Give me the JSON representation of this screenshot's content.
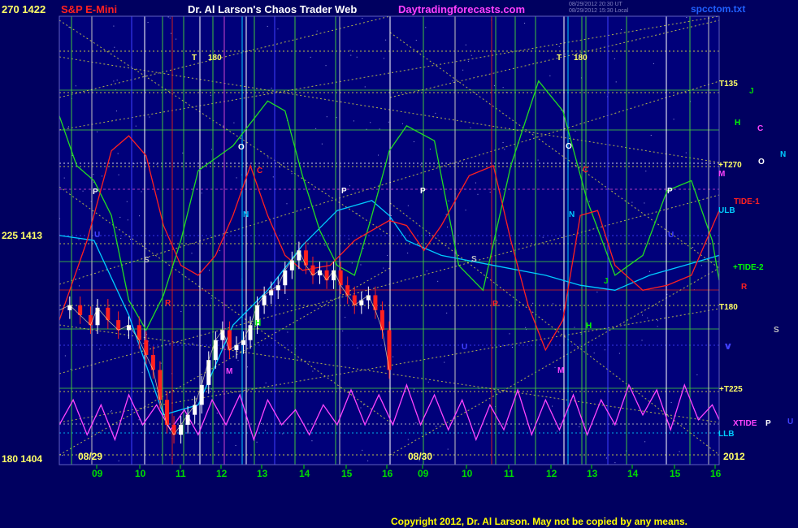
{
  "header": {
    "left_label": "270 1422",
    "instrument": "S&P E-Mini",
    "title": "Dr. Al Larson's Chaos Trader Web",
    "site": "Daytradingforecasts.com",
    "stamp_line1": "08/29/2012 20:30 UT",
    "stamp_line2": "08/29/2012 15:30 Local",
    "file": "spcctom.txt"
  },
  "copyright": "Copyright 2012, Dr. Al Larson. May not be copied by any means.",
  "colors": {
    "background": "#000060",
    "plot_background": "#00007a",
    "title_white": "#ffffff",
    "instrument_red": "#ff2020",
    "site_magenta": "#ff40ff",
    "axis_yellow": "#ffff66",
    "grid_dotted": "#e0e040",
    "price_white": "#ffffff",
    "price_red": "#ff2020"
  },
  "chart_data": {
    "type": "line",
    "title": "S&P E-Mini",
    "xlabel": "",
    "ylabel": "",
    "ylim": [
      1404,
      1422
    ],
    "y_ticks": [
      {
        "label": "270 1422",
        "value": 1422
      },
      {
        "label": "225 1413",
        "value": 1413
      },
      {
        "label": "180 1404",
        "value": 1404
      }
    ],
    "x_tick_labels": [
      "09",
      "10",
      "11",
      "12",
      "13",
      "14",
      "15",
      "16",
      "09",
      "10",
      "11",
      "12",
      "13",
      "14",
      "15",
      "16"
    ],
    "date_labels": [
      "08/29",
      "08/30"
    ],
    "year_label": "2012",
    "grid": true,
    "right_labels": [
      {
        "text": "T135",
        "color": "#ffff66"
      },
      {
        "text": "J",
        "color": "#00dd00"
      },
      {
        "text": "H",
        "color": "#00ff00"
      },
      {
        "text": "C",
        "color": "#ff44ff"
      },
      {
        "text": "N",
        "color": "#00ccff"
      },
      {
        "text": "+T270",
        "color": "#ffff66"
      },
      {
        "text": "O",
        "color": "#ffffff"
      },
      {
        "text": "M",
        "color": "#ff44ff"
      },
      {
        "text": "TIDE-1",
        "color": "#ff2020"
      },
      {
        "text": "ULB",
        "color": "#00ccff"
      },
      {
        "text": "+TIDE-2",
        "color": "#00ff00"
      },
      {
        "text": "R",
        "color": "#ff2020"
      },
      {
        "text": "T180",
        "color": "#ffff66"
      },
      {
        "text": "S",
        "color": "#c0c0c0"
      },
      {
        "text": "V",
        "color": "#4040ff"
      },
      {
        "text": "+T225",
        "color": "#ffff66"
      },
      {
        "text": "XTIDE",
        "color": "#ff44ff"
      },
      {
        "text": "P",
        "color": "#ffffff"
      },
      {
        "text": "U",
        "color": "#4040ff"
      },
      {
        "text": "LLB",
        "color": "#00ccff"
      }
    ],
    "in_plot_labels": [
      {
        "text": "T",
        "color": "#ffff66"
      },
      {
        "text": "180",
        "color": "#ffff66"
      },
      {
        "text": "T",
        "color": "#ffff66"
      },
      {
        "text": "180",
        "color": "#ffff66"
      },
      {
        "text": "P",
        "color": "#ffffff"
      },
      {
        "text": "P",
        "color": "#ffffff"
      },
      {
        "text": "P",
        "color": "#ffffff"
      },
      {
        "text": "P",
        "color": "#ffffff"
      },
      {
        "text": "O",
        "color": "#ffffff"
      },
      {
        "text": "O",
        "color": "#ffffff"
      },
      {
        "text": "C",
        "color": "#ff2020"
      },
      {
        "text": "C",
        "color": "#ff2020"
      },
      {
        "text": "N",
        "color": "#00ccff"
      },
      {
        "text": "N",
        "color": "#00ccff"
      },
      {
        "text": "S",
        "color": "#c0c0c0"
      },
      {
        "text": "S",
        "color": "#c0c0c0"
      },
      {
        "text": "R",
        "color": "#ff2020"
      },
      {
        "text": "R",
        "color": "#ff2020"
      },
      {
        "text": "M",
        "color": "#ff44ff"
      },
      {
        "text": "M",
        "color": "#ff44ff"
      },
      {
        "text": "H",
        "color": "#00ff00"
      },
      {
        "text": "H",
        "color": "#00ff00"
      },
      {
        "text": "J",
        "color": "#00dd00"
      },
      {
        "text": "V",
        "color": "#4040ff"
      },
      {
        "text": "U",
        "color": "#4040ff"
      },
      {
        "text": "U",
        "color": "#4040ff"
      },
      {
        "text": "U",
        "color": "#4040ff"
      }
    ],
    "series": [
      {
        "name": "S&P E-Mini price",
        "color": "#ffffff",
        "points": [
          [
            0,
            1410.2
          ],
          [
            3,
            1410.4
          ],
          [
            6,
            1410.0
          ],
          [
            9,
            1409.6
          ],
          [
            11,
            1410.3
          ],
          [
            14,
            1409.8
          ],
          [
            17,
            1409.4
          ],
          [
            20,
            1409.6
          ],
          [
            23,
            1409.0
          ],
          [
            25,
            1408.4
          ],
          [
            27,
            1407.8
          ],
          [
            29,
            1406.6
          ],
          [
            31,
            1405.6
          ],
          [
            33,
            1405.2
          ],
          [
            35,
            1405.6
          ],
          [
            37,
            1406.0
          ],
          [
            39,
            1406.4
          ],
          [
            41,
            1407.2
          ],
          [
            43,
            1408.2
          ],
          [
            45,
            1409.0
          ],
          [
            47,
            1409.4
          ],
          [
            49,
            1408.6
          ],
          [
            51,
            1408.8
          ],
          [
            53,
            1409.0
          ],
          [
            55,
            1409.6
          ],
          [
            57,
            1410.4
          ],
          [
            59,
            1410.8
          ],
          [
            61,
            1411.0
          ],
          [
            63,
            1411.2
          ],
          [
            65,
            1411.8
          ],
          [
            67,
            1412.2
          ],
          [
            69,
            1412.6
          ],
          [
            71,
            1412.0
          ],
          [
            73,
            1411.6
          ],
          [
            75,
            1411.8
          ],
          [
            77,
            1411.4
          ],
          [
            79,
            1411.8
          ],
          [
            81,
            1411.2
          ],
          [
            83,
            1410.8
          ],
          [
            85,
            1410.4
          ],
          [
            87,
            1410.6
          ],
          [
            89,
            1410.8
          ],
          [
            91,
            1410.2
          ],
          [
            93,
            1409.4
          ],
          [
            95,
            1407.8
          ]
        ]
      },
      {
        "name": "",
        "color": "#00ccff",
        "points": [
          [
            0,
            1413.2
          ],
          [
            10,
            1413.0
          ],
          [
            20,
            1410.0
          ],
          [
            30,
            1406.0
          ],
          [
            40,
            1406.4
          ],
          [
            50,
            1409.6
          ],
          [
            60,
            1411.0
          ],
          [
            70,
            1412.8
          ],
          [
            80,
            1414.2
          ],
          [
            90,
            1414.6
          ],
          [
            95,
            1414.0
          ],
          [
            100,
            1413.0
          ],
          [
            110,
            1412.4
          ],
          [
            125,
            1412.0
          ],
          [
            140,
            1411.6
          ],
          [
            150,
            1411.2
          ],
          [
            160,
            1411.0
          ],
          [
            170,
            1411.6
          ],
          [
            180,
            1412.0
          ],
          [
            190,
            1412.4
          ]
        ]
      },
      {
        "name": "",
        "color": "#22dd22",
        "points": [
          [
            0,
            1418.0
          ],
          [
            5,
            1416.0
          ],
          [
            10,
            1415.4
          ],
          [
            15,
            1414.0
          ],
          [
            20,
            1410.6
          ],
          [
            25,
            1409.4
          ],
          [
            30,
            1410.8
          ],
          [
            35,
            1413.0
          ],
          [
            40,
            1415.8
          ],
          [
            50,
            1416.8
          ],
          [
            60,
            1418.6
          ],
          [
            65,
            1418.2
          ],
          [
            70,
            1415.6
          ],
          [
            75,
            1413.4
          ],
          [
            80,
            1412.0
          ],
          [
            85,
            1411.6
          ],
          [
            90,
            1414.0
          ],
          [
            95,
            1416.6
          ],
          [
            100,
            1417.6
          ],
          [
            108,
            1417.0
          ],
          [
            115,
            1412.0
          ],
          [
            122,
            1411.0
          ],
          [
            130,
            1416.0
          ],
          [
            138,
            1419.4
          ],
          [
            145,
            1418.2
          ],
          [
            152,
            1414.6
          ],
          [
            160,
            1411.6
          ],
          [
            168,
            1412.4
          ],
          [
            175,
            1415.0
          ],
          [
            182,
            1415.4
          ],
          [
            188,
            1413.0
          ],
          [
            190,
            1411.4
          ]
        ]
      },
      {
        "name": "",
        "color": "#ff2020",
        "points": [
          [
            0,
            1409.8
          ],
          [
            8,
            1413.0
          ],
          [
            15,
            1416.6
          ],
          [
            20,
            1417.2
          ],
          [
            25,
            1416.4
          ],
          [
            30,
            1413.6
          ],
          [
            35,
            1412.0
          ],
          [
            40,
            1411.6
          ],
          [
            45,
            1412.4
          ],
          [
            50,
            1414.0
          ],
          [
            55,
            1416.0
          ],
          [
            60,
            1414.0
          ],
          [
            65,
            1412.4
          ],
          [
            70,
            1411.8
          ],
          [
            78,
            1412.0
          ],
          [
            85,
            1413.0
          ],
          [
            90,
            1413.4
          ],
          [
            95,
            1413.8
          ],
          [
            100,
            1413.6
          ],
          [
            105,
            1412.6
          ],
          [
            110,
            1413.6
          ],
          [
            118,
            1415.6
          ],
          [
            125,
            1416.0
          ],
          [
            130,
            1413.0
          ],
          [
            135,
            1410.4
          ],
          [
            140,
            1408.6
          ],
          [
            145,
            1409.8
          ],
          [
            150,
            1414.0
          ],
          [
            155,
            1414.2
          ],
          [
            160,
            1412.0
          ],
          [
            168,
            1411.0
          ],
          [
            175,
            1411.2
          ],
          [
            182,
            1411.6
          ],
          [
            190,
            1414.2
          ]
        ]
      },
      {
        "name": "",
        "color": "#ff44ff",
        "points": [
          [
            0,
            1405.6
          ],
          [
            4,
            1406.6
          ],
          [
            8,
            1405.2
          ],
          [
            12,
            1406.4
          ],
          [
            16,
            1405.0
          ],
          [
            20,
            1406.8
          ],
          [
            24,
            1405.6
          ],
          [
            28,
            1406.4
          ],
          [
            32,
            1405.4
          ],
          [
            36,
            1406.2
          ],
          [
            40,
            1405.2
          ],
          [
            44,
            1406.6
          ],
          [
            48,
            1405.6
          ],
          [
            52,
            1406.8
          ],
          [
            56,
            1405.0
          ],
          [
            60,
            1406.6
          ],
          [
            64,
            1405.6
          ],
          [
            68,
            1406.2
          ],
          [
            72,
            1405.2
          ],
          [
            76,
            1406.4
          ],
          [
            80,
            1405.6
          ],
          [
            84,
            1407.0
          ],
          [
            88,
            1405.6
          ],
          [
            92,
            1406.8
          ],
          [
            96,
            1405.6
          ],
          [
            100,
            1407.2
          ],
          [
            104,
            1405.6
          ],
          [
            108,
            1406.8
          ],
          [
            112,
            1405.4
          ],
          [
            116,
            1406.6
          ],
          [
            120,
            1405.0
          ],
          [
            124,
            1406.4
          ],
          [
            128,
            1405.4
          ],
          [
            132,
            1407.0
          ],
          [
            136,
            1405.2
          ],
          [
            140,
            1406.6
          ],
          [
            144,
            1405.4
          ],
          [
            148,
            1406.8
          ],
          [
            152,
            1405.2
          ],
          [
            156,
            1406.6
          ],
          [
            160,
            1405.6
          ],
          [
            164,
            1407.2
          ],
          [
            168,
            1406.0
          ],
          [
            172,
            1407.0
          ],
          [
            176,
            1405.4
          ],
          [
            180,
            1407.2
          ],
          [
            184,
            1405.8
          ],
          [
            188,
            1406.4
          ],
          [
            190,
            1405.8
          ]
        ]
      }
    ]
  }
}
